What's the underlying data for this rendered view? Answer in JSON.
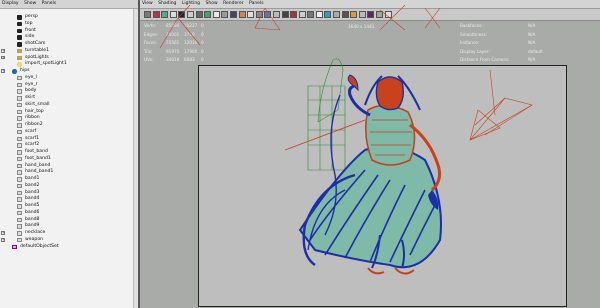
{
  "outliner": {
    "menu": [
      "Display",
      "Show",
      "Panels"
    ],
    "items": [
      {
        "label": "persp",
        "icon": "camera-icon",
        "expander": false,
        "indent": 1
      },
      {
        "label": "top",
        "icon": "camera-icon",
        "expander": false,
        "indent": 1
      },
      {
        "label": "front",
        "icon": "camera-icon",
        "expander": false,
        "indent": 1
      },
      {
        "label": "side",
        "icon": "camera-icon",
        "expander": false,
        "indent": 1
      },
      {
        "label": "shotCam",
        "icon": "camera-icon",
        "expander": false,
        "indent": 1
      },
      {
        "label": "turntable1",
        "icon": "group-icon",
        "expander": true,
        "indent": 1
      },
      {
        "label": "spotLights",
        "icon": "group-icon",
        "expander": true,
        "indent": 1
      },
      {
        "label": "import_spotLight1",
        "icon": "light-icon",
        "expander": false,
        "indent": 1
      },
      {
        "label": "hips",
        "icon": "joint-icon",
        "expander": true,
        "indent": 0
      },
      {
        "label": "eye_l",
        "icon": "mesh-icon",
        "expander": false,
        "indent": 1
      },
      {
        "label": "eye_r",
        "icon": "mesh-icon",
        "expander": false,
        "indent": 1
      },
      {
        "label": "body",
        "icon": "mesh-icon",
        "expander": false,
        "indent": 1
      },
      {
        "label": "skirt",
        "icon": "mesh-icon",
        "expander": false,
        "indent": 1
      },
      {
        "label": "skirt_small",
        "icon": "mesh-icon",
        "expander": false,
        "indent": 1
      },
      {
        "label": "hair_top",
        "icon": "mesh-icon",
        "expander": false,
        "indent": 1
      },
      {
        "label": "ribbon",
        "icon": "mesh-icon",
        "expander": false,
        "indent": 1
      },
      {
        "label": "ribbon2",
        "icon": "mesh-icon",
        "expander": false,
        "indent": 1
      },
      {
        "label": "scarf",
        "icon": "mesh-icon",
        "expander": false,
        "indent": 1
      },
      {
        "label": "scarf1",
        "icon": "mesh-icon",
        "expander": false,
        "indent": 1
      },
      {
        "label": "scarf2",
        "icon": "mesh-icon",
        "expander": false,
        "indent": 1
      },
      {
        "label": "foot_band",
        "icon": "mesh-icon",
        "expander": false,
        "indent": 1
      },
      {
        "label": "foot_band1",
        "icon": "mesh-icon",
        "expander": false,
        "indent": 1
      },
      {
        "label": "hand_band",
        "icon": "mesh-icon",
        "expander": false,
        "indent": 1
      },
      {
        "label": "hand_band1",
        "icon": "mesh-icon",
        "expander": false,
        "indent": 1
      },
      {
        "label": "band1",
        "icon": "mesh-icon",
        "expander": false,
        "indent": 1
      },
      {
        "label": "band2",
        "icon": "mesh-icon",
        "expander": false,
        "indent": 1
      },
      {
        "label": "band3",
        "icon": "mesh-icon",
        "expander": false,
        "indent": 1
      },
      {
        "label": "band4",
        "icon": "mesh-icon",
        "expander": false,
        "indent": 1
      },
      {
        "label": "band5",
        "icon": "mesh-icon",
        "expander": false,
        "indent": 1
      },
      {
        "label": "band6",
        "icon": "mesh-icon",
        "expander": false,
        "indent": 1
      },
      {
        "label": "band8",
        "icon": "mesh-icon",
        "expander": false,
        "indent": 1
      },
      {
        "label": "band9",
        "icon": "mesh-icon",
        "expander": false,
        "indent": 1
      },
      {
        "label": "necklace",
        "icon": "mesh-icon",
        "expander": true,
        "indent": 1
      },
      {
        "label": "weapon",
        "icon": "mesh-icon",
        "expander": true,
        "indent": 1
      },
      {
        "label": "defaultObjectSet",
        "icon": "set-icon",
        "expander": false,
        "indent": 0
      }
    ]
  },
  "viewport": {
    "menu": [
      "View",
      "Shading",
      "Lighting",
      "Show",
      "Renderer",
      "Panels"
    ],
    "resolution": "1640 x 1441",
    "hud_left": [
      {
        "label": "Verts:",
        "a": "85094",
        "b": "10227",
        "c": "0"
      },
      {
        "label": "Edges:",
        "a": "20001",
        "b": "3716",
        "c": "0"
      },
      {
        "label": "Faces:",
        "a": "55561",
        "b": "12010",
        "c": "0"
      },
      {
        "label": "Tris:",
        "a": "91975",
        "b": "17900",
        "c": "0"
      },
      {
        "label": "UVs:",
        "a": "34018",
        "b": "6083",
        "c": "0"
      }
    ],
    "hud_right": [
      {
        "label": "Backfaces:",
        "value": "N/A"
      },
      {
        "label": "Smoothness:",
        "value": "N/A"
      },
      {
        "label": "Instance:",
        "value": "N/A"
      },
      {
        "label": "Display Layer:",
        "value": "default"
      },
      {
        "label": "Distance From Camera:",
        "value": "N/A"
      },
      {
        "label": "Selected Objects:",
        "value": "0"
      }
    ],
    "colors": {
      "mesh_blue": "#1c2fa6",
      "mesh_red": "#c8421e",
      "mesh_teal": "#7fb9a8",
      "selection_green": "#2f8c2f"
    }
  }
}
